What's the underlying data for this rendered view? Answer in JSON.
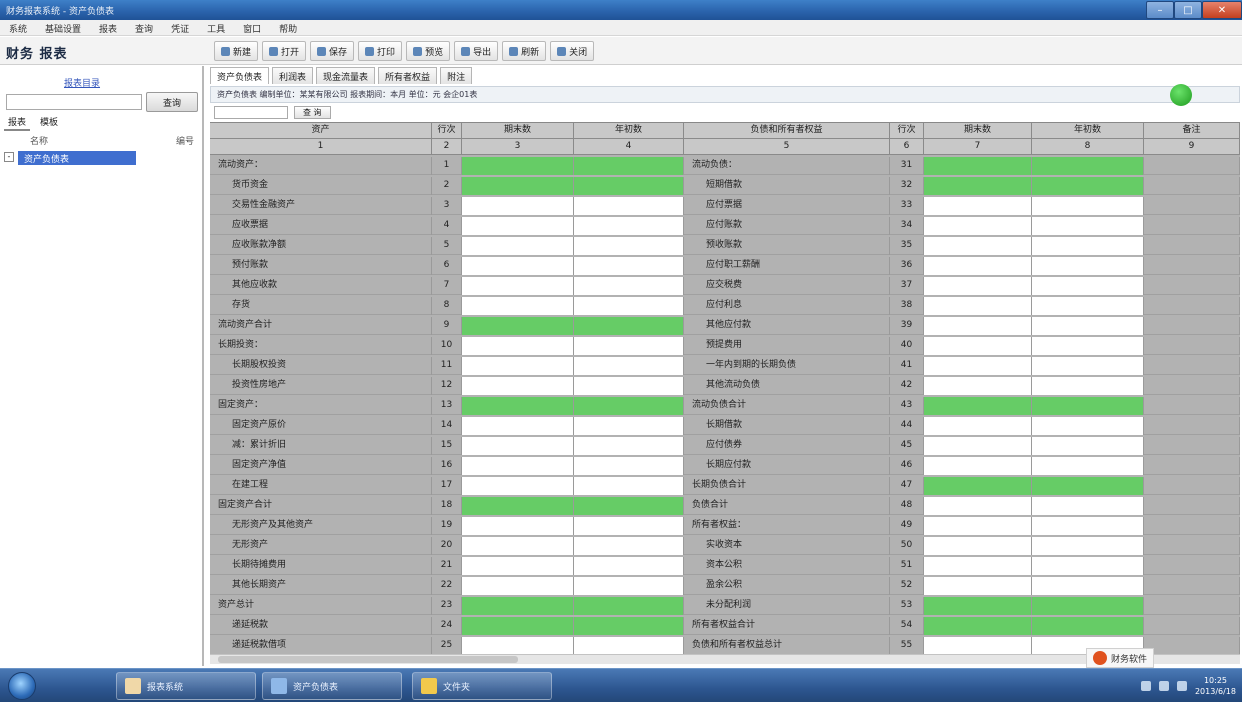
{
  "window": {
    "title": "财务报表系统 - 资产负债表",
    "menu": [
      "系统",
      "基础设置",
      "报表",
      "查询",
      "凭证",
      "工具",
      "窗口",
      "帮助"
    ]
  },
  "toolbar": {
    "brand": "财务 报表",
    "buttons": [
      "新建",
      "打开",
      "保存",
      "打印",
      "预览",
      "导出",
      "刷新",
      "关闭"
    ]
  },
  "left_panel": {
    "link": "报表目录",
    "search_placeholder": "",
    "search_button": "查询",
    "tabs": [
      "报表",
      "模板"
    ],
    "tree_header_left": "名称",
    "tree_header_right": "编号",
    "tree_toggle": "-",
    "tree_node": "资产负债表"
  },
  "report": {
    "tabs": [
      "资产负债表",
      "利润表",
      "现金流量表",
      "所有者权益",
      "附注"
    ],
    "crumb": "资产负债表  编制单位：某某有限公司  报表期间：本月  单位：元  会企01表",
    "filter_button": "查  询"
  },
  "grid": {
    "headers": [
      "资产",
      "行次",
      "期末数",
      "年初数",
      "负债和所有者权益",
      "行次",
      "期末数",
      "年初数",
      "备注"
    ],
    "subheaders": [
      "1",
      "2",
      "3",
      "4",
      "5",
      "6",
      "7",
      "8",
      "9"
    ],
    "rows": [
      {
        "a": "流动资产：",
        "l": "1",
        "a1": "",
        "a2": "",
        "b": "流动负债：",
        "r": "31",
        "b1": "",
        "b2": "",
        "note": "",
        "gl": true,
        "gr": true
      },
      {
        "a": "货币资金",
        "l": "2",
        "a1": "",
        "a2": "",
        "b": "短期借款",
        "r": "32",
        "b1": "",
        "b2": "",
        "note": "",
        "gl": true,
        "gr": true
      },
      {
        "a": "交易性金融资产",
        "l": "3",
        "a1": "",
        "a2": "",
        "b": "应付票据",
        "r": "33",
        "b1": "",
        "b2": "",
        "note": "",
        "gl": false,
        "gr": false
      },
      {
        "a": "应收票据",
        "l": "4",
        "a1": "",
        "a2": "",
        "b": "应付账款",
        "r": "34",
        "b1": "",
        "b2": "",
        "note": "",
        "gl": false,
        "gr": false
      },
      {
        "a": "应收账款净额",
        "l": "5",
        "a1": "",
        "a2": "",
        "b": "预收账款",
        "r": "35",
        "b1": "",
        "b2": "",
        "note": "",
        "gl": false,
        "gr": false
      },
      {
        "a": "预付账款",
        "l": "6",
        "a1": "",
        "a2": "",
        "b": "应付职工薪酬",
        "r": "36",
        "b1": "",
        "b2": "",
        "note": "",
        "gl": false,
        "gr": false
      },
      {
        "a": "其他应收款",
        "l": "7",
        "a1": "",
        "a2": "",
        "b": "应交税费",
        "r": "37",
        "b1": "",
        "b2": "",
        "note": "",
        "gl": false,
        "gr": false
      },
      {
        "a": "存货",
        "l": "8",
        "a1": "",
        "a2": "",
        "b": "应付利息",
        "r": "38",
        "b1": "",
        "b2": "",
        "note": "",
        "gl": false,
        "gr": false
      },
      {
        "a": "流动资产合计",
        "l": "9",
        "a1": "",
        "a2": "",
        "b": "其他应付款",
        "r": "39",
        "b1": "",
        "b2": "",
        "note": "",
        "gl": true,
        "gr": false
      },
      {
        "a": "长期投资：",
        "l": "10",
        "a1": "",
        "a2": "",
        "b": "预提费用",
        "r": "40",
        "b1": "",
        "b2": "",
        "note": "",
        "gl": false,
        "gr": false
      },
      {
        "a": "长期股权投资",
        "l": "11",
        "a1": "",
        "a2": "",
        "b": "一年内到期的长期负债",
        "r": "41",
        "b1": "",
        "b2": "",
        "note": "",
        "gl": false,
        "gr": false
      },
      {
        "a": "投资性房地产",
        "l": "12",
        "a1": "",
        "a2": "",
        "b": "其他流动负债",
        "r": "42",
        "b1": "",
        "b2": "",
        "note": "",
        "gl": false,
        "gr": false
      },
      {
        "a": "固定资产：",
        "l": "13",
        "a1": "",
        "a2": "",
        "b": "流动负债合计",
        "r": "43",
        "b1": "",
        "b2": "",
        "note": "",
        "gl": true,
        "gr": true
      },
      {
        "a": "固定资产原价",
        "l": "14",
        "a1": "",
        "a2": "",
        "b": "长期借款",
        "r": "44",
        "b1": "",
        "b2": "",
        "note": "",
        "gl": false,
        "gr": false
      },
      {
        "a": "减：累计折旧",
        "l": "15",
        "a1": "",
        "a2": "",
        "b": "应付债券",
        "r": "45",
        "b1": "",
        "b2": "",
        "note": "",
        "gl": false,
        "gr": false
      },
      {
        "a": "固定资产净值",
        "l": "16",
        "a1": "",
        "a2": "",
        "b": "长期应付款",
        "r": "46",
        "b1": "",
        "b2": "",
        "note": "",
        "gl": false,
        "gr": false
      },
      {
        "a": "在建工程",
        "l": "17",
        "a1": "",
        "a2": "",
        "b": "长期负债合计",
        "r": "47",
        "b1": "",
        "b2": "",
        "note": "",
        "gl": false,
        "gr": true
      },
      {
        "a": "固定资产合计",
        "l": "18",
        "a1": "",
        "a2": "",
        "b": "负债合计",
        "r": "48",
        "b1": "",
        "b2": "",
        "note": "",
        "gl": true,
        "gr": false
      },
      {
        "a": "无形资产及其他资产",
        "l": "19",
        "a1": "",
        "a2": "",
        "b": "所有者权益：",
        "r": "49",
        "b1": "",
        "b2": "",
        "note": "",
        "gl": false,
        "gr": false
      },
      {
        "a": "无形资产",
        "l": "20",
        "a1": "",
        "a2": "",
        "b": "实收资本",
        "r": "50",
        "b1": "",
        "b2": "",
        "note": "",
        "gl": false,
        "gr": false
      },
      {
        "a": "长期待摊费用",
        "l": "21",
        "a1": "",
        "a2": "",
        "b": "资本公积",
        "r": "51",
        "b1": "",
        "b2": "",
        "note": "",
        "gl": false,
        "gr": false
      },
      {
        "a": "其他长期资产",
        "l": "22",
        "a1": "",
        "a2": "",
        "b": "盈余公积",
        "r": "52",
        "b1": "",
        "b2": "",
        "note": "",
        "gl": false,
        "gr": false
      },
      {
        "a": "资产总计",
        "l": "23",
        "a1": "",
        "a2": "",
        "b": "未分配利润",
        "r": "53",
        "b1": "",
        "b2": "",
        "note": "",
        "gl": true,
        "gr": true
      },
      {
        "a": "递延税款",
        "l": "24",
        "a1": "",
        "a2": "",
        "b": "所有者权益合计",
        "r": "54",
        "b1": "",
        "b2": "",
        "note": "",
        "gl": true,
        "gr": true
      },
      {
        "a": "递延税款借项",
        "l": "25",
        "a1": "",
        "a2": "",
        "b": "负债和所有者权益总计",
        "r": "55",
        "b1": "",
        "b2": "",
        "note": "",
        "gl": false,
        "gr": false
      }
    ]
  },
  "status": {
    "brand_badge": "财务软件"
  },
  "taskbar": {
    "items": [
      "报表系统",
      "资产负债表",
      "文件夹"
    ],
    "time": "10:25",
    "date": "2013/6/18"
  },
  "colors": {
    "green_cell": "#66cc66",
    "grid_bg": "#b2b2b2",
    "title_blue": "#2b64ad"
  }
}
